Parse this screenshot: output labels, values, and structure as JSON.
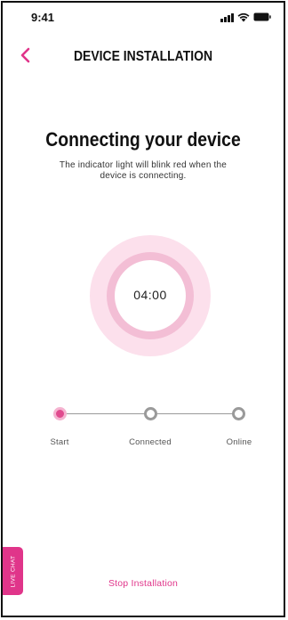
{
  "status_bar": {
    "time": "9:41",
    "icons": [
      "signal-icon",
      "wifi-icon",
      "battery-icon"
    ]
  },
  "nav": {
    "back_icon": "chevron-left-icon",
    "title": "DEVICE INSTALLATION"
  },
  "main": {
    "heading": "Connecting your device",
    "subtext_line1": "The indicator light will blink red when the",
    "subtext_line2": "device is connecting."
  },
  "timer": {
    "value": "04:00"
  },
  "stepper": {
    "current_step": 0,
    "steps": [
      {
        "label": "Start",
        "state": "active"
      },
      {
        "label": "Connected",
        "state": "inactive"
      },
      {
        "label": "Online",
        "state": "inactive"
      }
    ]
  },
  "live_chat": {
    "label": "LIVE CHAT"
  },
  "footer": {
    "stop_label": "Stop Installation"
  },
  "colors": {
    "accent": "#e0358a",
    "timer_outer": "#fce0ec",
    "timer_ring": "#f3bed5",
    "step_inactive": "#9a9a9a"
  }
}
